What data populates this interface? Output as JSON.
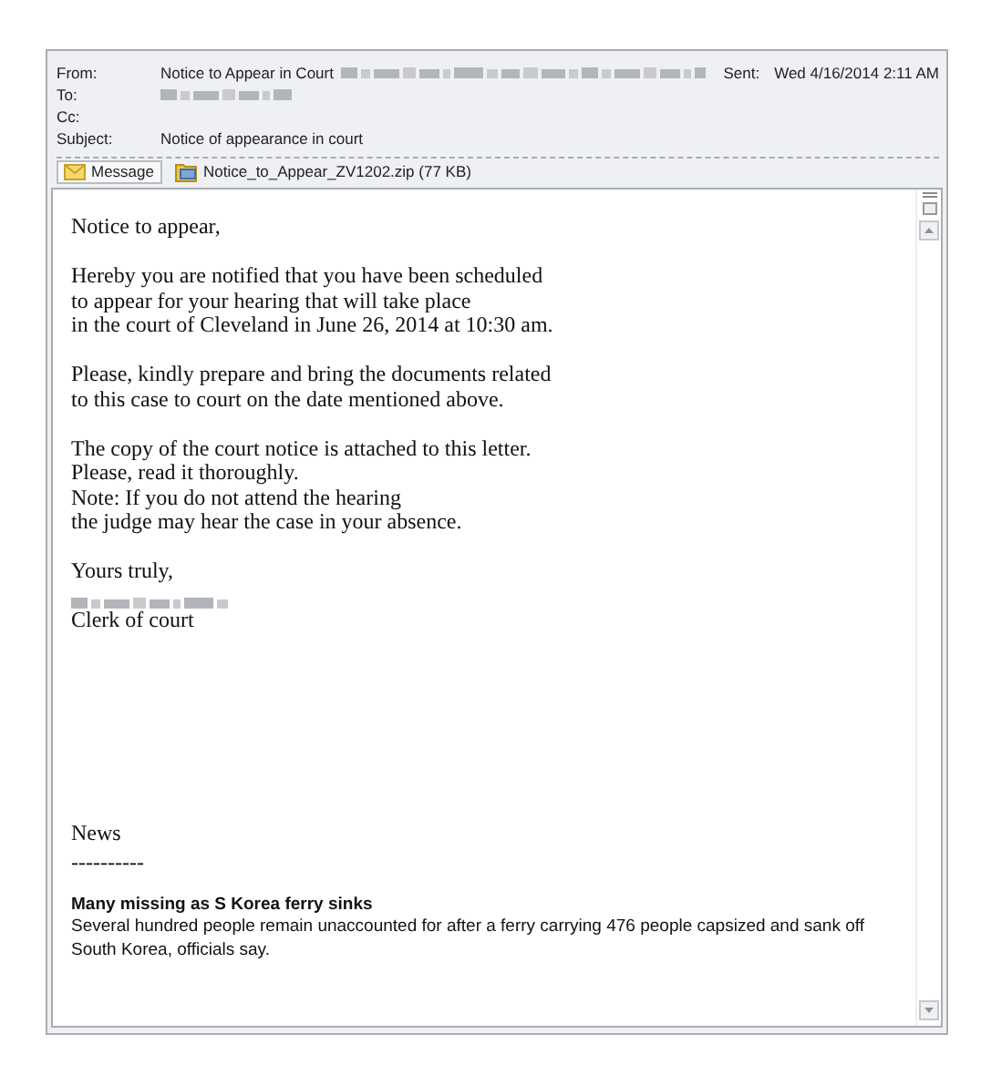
{
  "header": {
    "fields": [
      {
        "label": "From:",
        "value": "Notice to Appear in Court",
        "redacted": true
      },
      {
        "label": "To:",
        "redacted": true
      },
      {
        "label": "Cc:"
      },
      {
        "label": "Subject:",
        "value": "Notice of appearance in court"
      }
    ],
    "sent": {
      "label": "Sent:",
      "value": "Wed 4/16/2014 2:11 AM"
    }
  },
  "attachments": [
    {
      "kind": "message",
      "label": "Message",
      "selected": true
    },
    {
      "kind": "file",
      "label": "Notice_to_Appear_ZV1202.zip (77 KB)",
      "selected": false
    }
  ],
  "body": {
    "paragraphs": [
      [
        "Notice to appear,"
      ],
      [
        "Hereby you are notified that you have been scheduled",
        "to appear for your hearing that will take place",
        "in the court of Cleveland in June 26, 2014 at 10:30 am."
      ],
      [
        "Please, kindly prepare and bring the documents related",
        "to this case to court on the date mentioned above."
      ],
      [
        "The copy of the court notice is attached to this letter.",
        "Please, read it thoroughly.",
        "Note: If you do not attend the hearing",
        "the judge may hear the case in your absence."
      ]
    ],
    "signature": {
      "closing": "Yours truly,",
      "redacted": true,
      "title": "Clerk of court"
    },
    "news": {
      "heading": "News",
      "rule": "----------",
      "headline": "Many missing as S Korea ferry sinks",
      "summary": "Several hundred people remain unaccounted for after a ferry carrying 476 people capsized and sank off South Korea, officials say."
    }
  }
}
